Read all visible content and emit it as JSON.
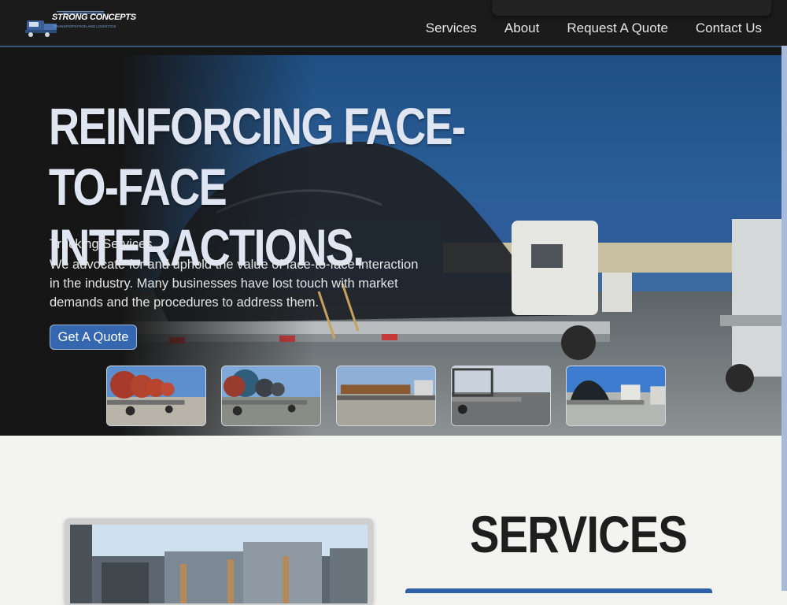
{
  "brand": {
    "name": "STRONG CONCEPTS",
    "tagline": "TRANSPORTATION AND LOGISTICS",
    "accent": "#3566b0"
  },
  "nav": {
    "items": [
      "Services",
      "About",
      "Request A Quote",
      "Contact Us"
    ]
  },
  "hero": {
    "title": "REINFORCING FACE-TO-FACE INTERACTIONS.",
    "subtitle": "Trucking Services.",
    "body": "We advocate for and uphold the value of face-to-face interaction in the industry. Many businesses have lost touch with market demands and the procedures to address them.",
    "cta_label": "Get A Quote"
  },
  "services": {
    "title": "SERVICES"
  },
  "colors": {
    "navbar_bg": "#1b1b1b",
    "hero_title": "#dfe6f2",
    "page_bg": "#f3f3f1",
    "button": "#3566b0"
  }
}
